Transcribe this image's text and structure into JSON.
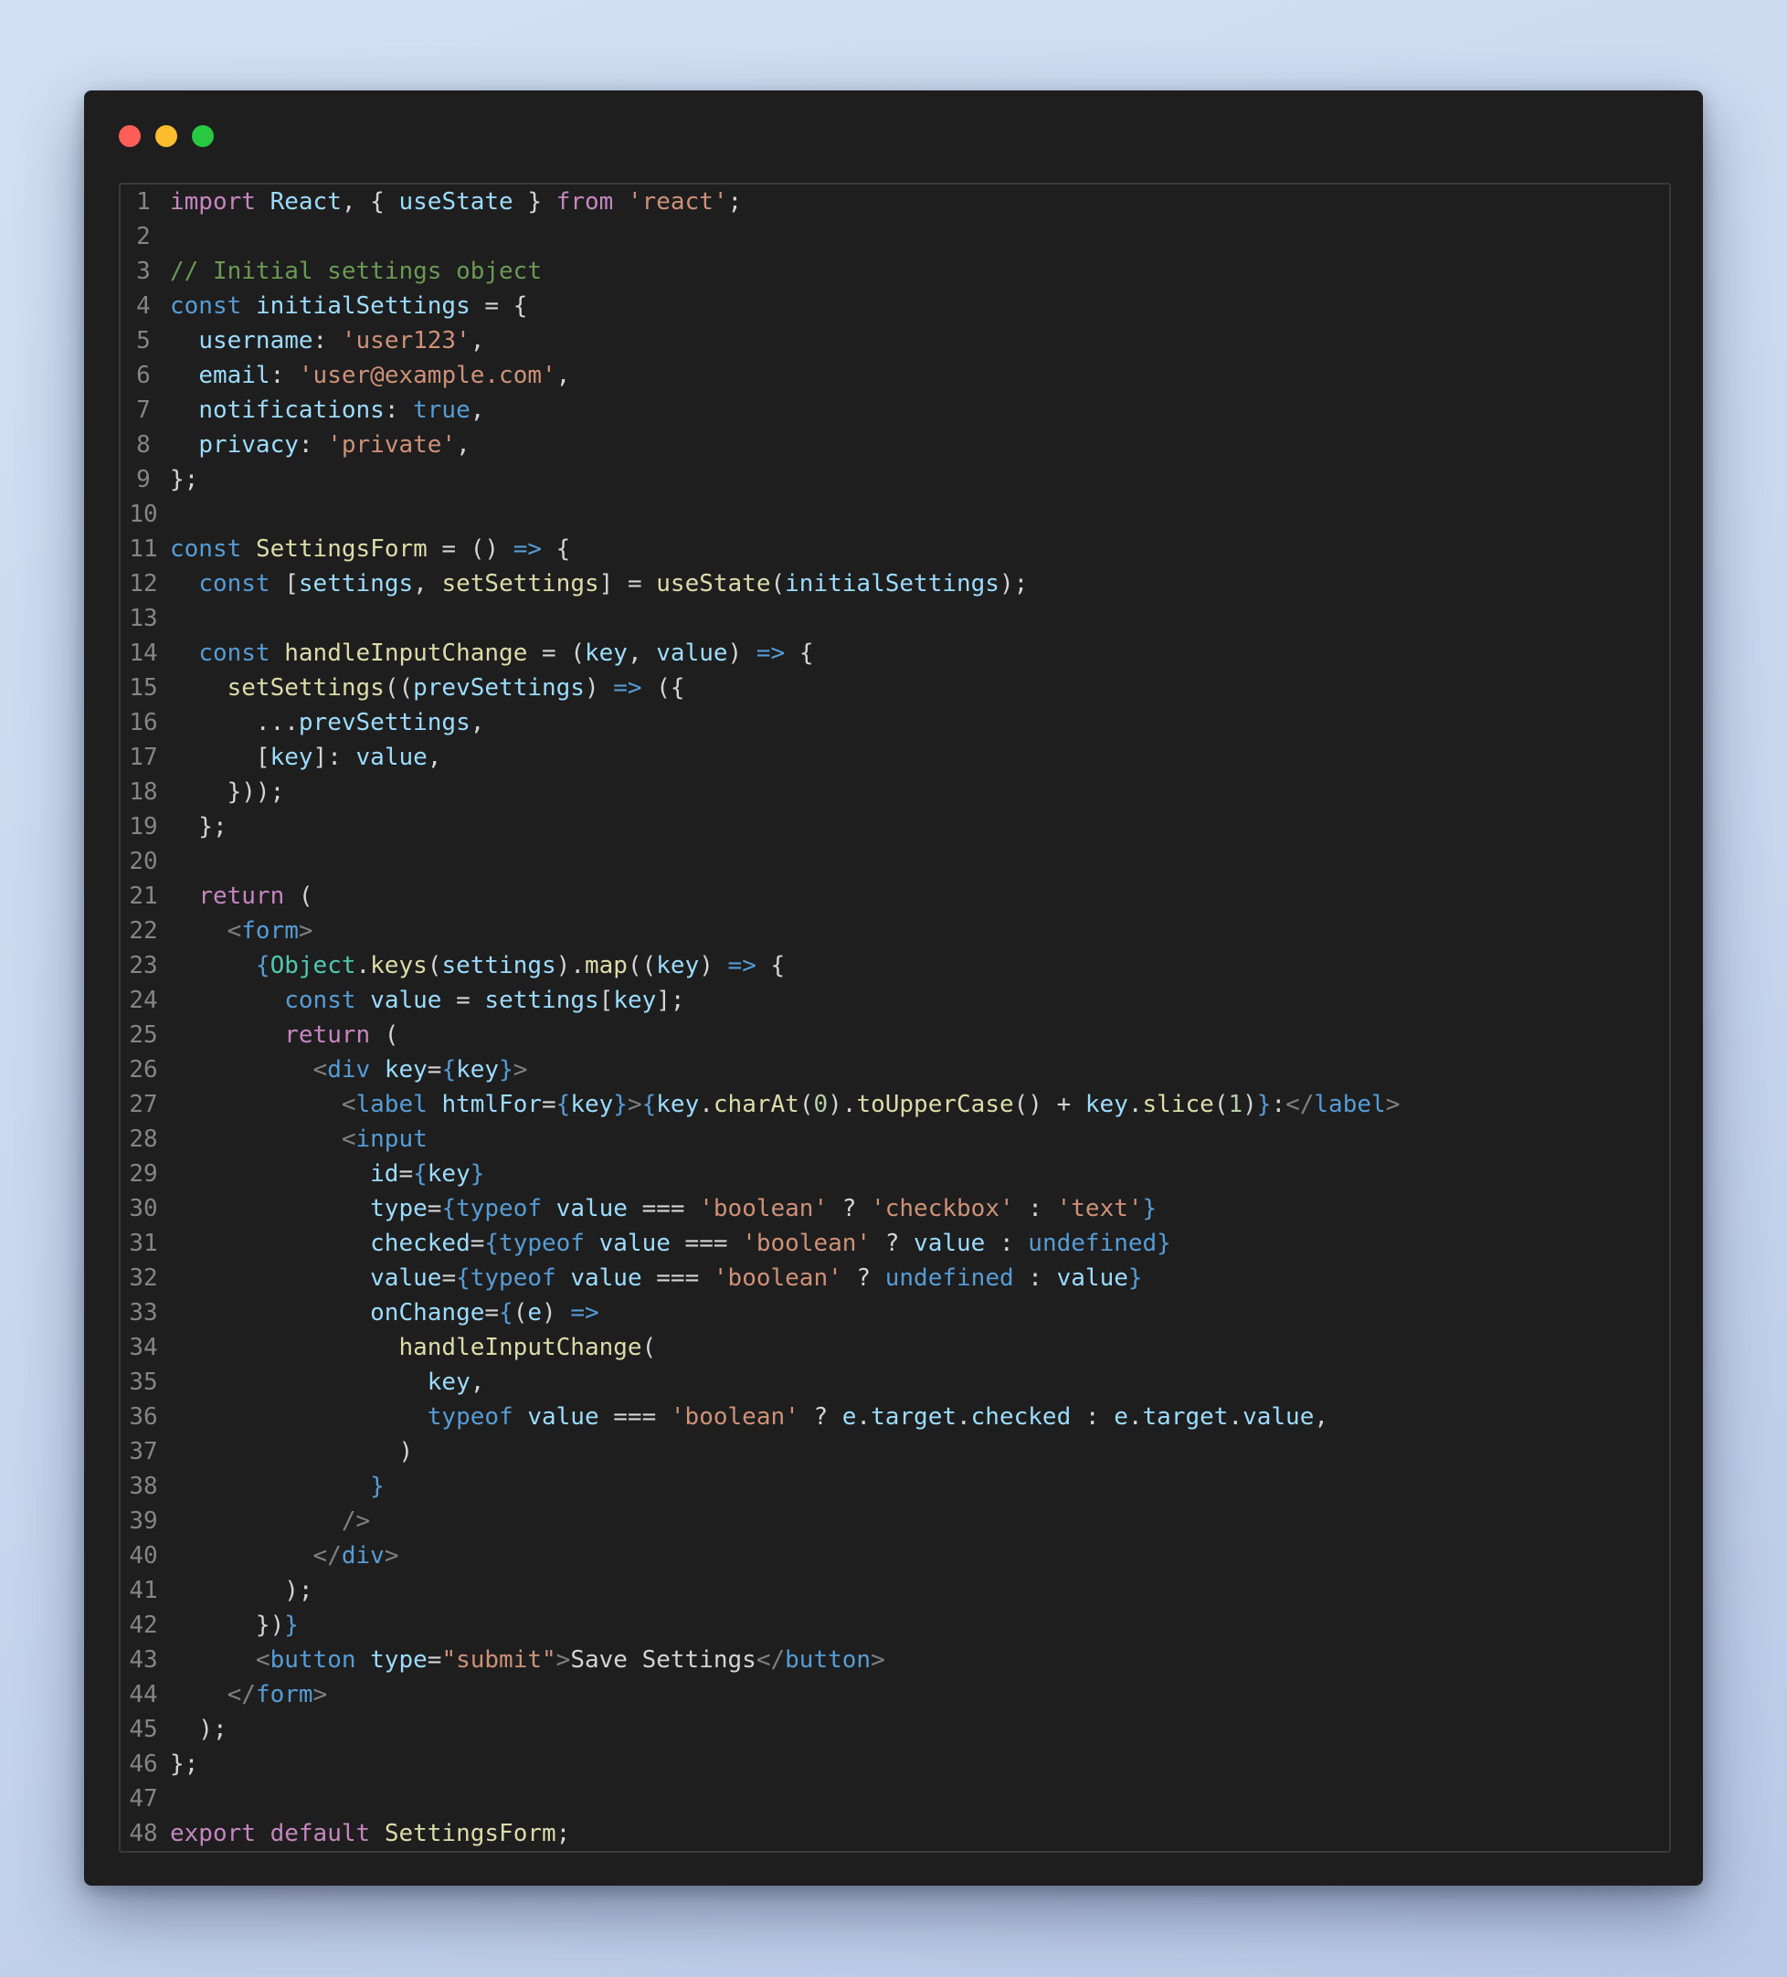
{
  "window": {
    "controls": [
      "close",
      "minimize",
      "zoom"
    ],
    "colors": {
      "close": "#ff5f57",
      "minimize": "#febc2e",
      "zoom": "#28c840",
      "background": "#1e1e1e"
    }
  },
  "code": {
    "language": "javascript",
    "lines": [
      [
        [
          "kw",
          "import"
        ],
        [
          "p",
          " "
        ],
        [
          "vr",
          "React"
        ],
        [
          "p",
          ", { "
        ],
        [
          "vr",
          "useState"
        ],
        [
          "p",
          " } "
        ],
        [
          "kw",
          "from"
        ],
        [
          "p",
          " "
        ],
        [
          "s",
          "'react'"
        ],
        [
          "p",
          ";"
        ]
      ],
      [],
      [
        [
          "cm",
          "// Initial settings object"
        ]
      ],
      [
        [
          "st",
          "const"
        ],
        [
          "p",
          " "
        ],
        [
          "vr",
          "initialSettings"
        ],
        [
          "p",
          " = {"
        ]
      ],
      [
        [
          "p",
          "  "
        ],
        [
          "vr",
          "username"
        ],
        [
          "p",
          ": "
        ],
        [
          "s",
          "'user123'"
        ],
        [
          "p",
          ","
        ]
      ],
      [
        [
          "p",
          "  "
        ],
        [
          "vr",
          "email"
        ],
        [
          "p",
          ": "
        ],
        [
          "s",
          "'user@example.com'"
        ],
        [
          "p",
          ","
        ]
      ],
      [
        [
          "p",
          "  "
        ],
        [
          "vr",
          "notifications"
        ],
        [
          "p",
          ": "
        ],
        [
          "st",
          "true"
        ],
        [
          "p",
          ","
        ]
      ],
      [
        [
          "p",
          "  "
        ],
        [
          "vr",
          "privacy"
        ],
        [
          "p",
          ": "
        ],
        [
          "s",
          "'private'"
        ],
        [
          "p",
          ","
        ]
      ],
      [
        [
          "p",
          "};"
        ]
      ],
      [],
      [
        [
          "st",
          "const"
        ],
        [
          "p",
          " "
        ],
        [
          "fn",
          "SettingsForm"
        ],
        [
          "p",
          " = () "
        ],
        [
          "st",
          "=>"
        ],
        [
          "p",
          " {"
        ]
      ],
      [
        [
          "p",
          "  "
        ],
        [
          "st",
          "const"
        ],
        [
          "p",
          " ["
        ],
        [
          "vr",
          "settings"
        ],
        [
          "p",
          ", "
        ],
        [
          "fn",
          "setSettings"
        ],
        [
          "p",
          "] = "
        ],
        [
          "fn",
          "useState"
        ],
        [
          "p",
          "("
        ],
        [
          "vr",
          "initialSettings"
        ],
        [
          "p",
          ");"
        ]
      ],
      [],
      [
        [
          "p",
          "  "
        ],
        [
          "st",
          "const"
        ],
        [
          "p",
          " "
        ],
        [
          "fn",
          "handleInputChange"
        ],
        [
          "p",
          " = ("
        ],
        [
          "vr",
          "key"
        ],
        [
          "p",
          ", "
        ],
        [
          "vr",
          "value"
        ],
        [
          "p",
          ") "
        ],
        [
          "st",
          "=>"
        ],
        [
          "p",
          " {"
        ]
      ],
      [
        [
          "p",
          "    "
        ],
        [
          "fn",
          "setSettings"
        ],
        [
          "p",
          "(("
        ],
        [
          "vr",
          "prevSettings"
        ],
        [
          "p",
          ") "
        ],
        [
          "st",
          "=>"
        ],
        [
          "p",
          " ({"
        ]
      ],
      [
        [
          "p",
          "      ..."
        ],
        [
          "vr",
          "prevSettings"
        ],
        [
          "p",
          ","
        ]
      ],
      [
        [
          "p",
          "      ["
        ],
        [
          "vr",
          "key"
        ],
        [
          "p",
          "]: "
        ],
        [
          "vr",
          "value"
        ],
        [
          "p",
          ","
        ]
      ],
      [
        [
          "p",
          "    }));"
        ]
      ],
      [
        [
          "p",
          "  };"
        ]
      ],
      [],
      [
        [
          "p",
          "  "
        ],
        [
          "kw",
          "return"
        ],
        [
          "p",
          " ("
        ]
      ],
      [
        [
          "p",
          "    "
        ],
        [
          "tg",
          "<"
        ],
        [
          "st",
          "form"
        ],
        [
          "tg",
          ">"
        ]
      ],
      [
        [
          "p",
          "      "
        ],
        [
          "st",
          "{"
        ],
        [
          "ty",
          "Object"
        ],
        [
          "p",
          "."
        ],
        [
          "fn",
          "keys"
        ],
        [
          "p",
          "("
        ],
        [
          "vr",
          "settings"
        ],
        [
          "p",
          ")."
        ],
        [
          "fn",
          "map"
        ],
        [
          "p",
          "(("
        ],
        [
          "vr",
          "key"
        ],
        [
          "p",
          ") "
        ],
        [
          "st",
          "=>"
        ],
        [
          "p",
          " {"
        ]
      ],
      [
        [
          "p",
          "        "
        ],
        [
          "st",
          "const"
        ],
        [
          "p",
          " "
        ],
        [
          "vr",
          "value"
        ],
        [
          "p",
          " = "
        ],
        [
          "vr",
          "settings"
        ],
        [
          "p",
          "["
        ],
        [
          "vr",
          "key"
        ],
        [
          "p",
          "];"
        ]
      ],
      [
        [
          "p",
          "        "
        ],
        [
          "kw",
          "return"
        ],
        [
          "p",
          " ("
        ]
      ],
      [
        [
          "p",
          "          "
        ],
        [
          "tg",
          "<"
        ],
        [
          "st",
          "div"
        ],
        [
          "p",
          " "
        ],
        [
          "vr",
          "key"
        ],
        [
          "p",
          "="
        ],
        [
          "st",
          "{"
        ],
        [
          "vr",
          "key"
        ],
        [
          "st",
          "}"
        ],
        [
          "tg",
          ">"
        ]
      ],
      [
        [
          "p",
          "            "
        ],
        [
          "tg",
          "<"
        ],
        [
          "st",
          "label"
        ],
        [
          "p",
          " "
        ],
        [
          "vr",
          "htmlFor"
        ],
        [
          "p",
          "="
        ],
        [
          "st",
          "{"
        ],
        [
          "vr",
          "key"
        ],
        [
          "st",
          "}"
        ],
        [
          "tg",
          ">"
        ],
        [
          "st",
          "{"
        ],
        [
          "vr",
          "key"
        ],
        [
          "p",
          "."
        ],
        [
          "fn",
          "charAt"
        ],
        [
          "p",
          "("
        ],
        [
          "nm",
          "0"
        ],
        [
          "p",
          ")."
        ],
        [
          "fn",
          "toUpperCase"
        ],
        [
          "p",
          "() + "
        ],
        [
          "vr",
          "key"
        ],
        [
          "p",
          "."
        ],
        [
          "fn",
          "slice"
        ],
        [
          "p",
          "("
        ],
        [
          "nm",
          "1"
        ],
        [
          "p",
          ")"
        ],
        [
          "st",
          "}"
        ],
        [
          "p",
          ":"
        ],
        [
          "tg",
          "</"
        ],
        [
          "st",
          "label"
        ],
        [
          "tg",
          ">"
        ]
      ],
      [
        [
          "p",
          "            "
        ],
        [
          "tg",
          "<"
        ],
        [
          "st",
          "input"
        ]
      ],
      [
        [
          "p",
          "              "
        ],
        [
          "vr",
          "id"
        ],
        [
          "p",
          "="
        ],
        [
          "st",
          "{"
        ],
        [
          "vr",
          "key"
        ],
        [
          "st",
          "}"
        ]
      ],
      [
        [
          "p",
          "              "
        ],
        [
          "vr",
          "type"
        ],
        [
          "p",
          "="
        ],
        [
          "st",
          "{typeof"
        ],
        [
          "p",
          " "
        ],
        [
          "vr",
          "value"
        ],
        [
          "p",
          " === "
        ],
        [
          "s",
          "'boolean'"
        ],
        [
          "p",
          " ? "
        ],
        [
          "s",
          "'checkbox'"
        ],
        [
          "p",
          " : "
        ],
        [
          "s",
          "'text'"
        ],
        [
          "st",
          "}"
        ]
      ],
      [
        [
          "p",
          "              "
        ],
        [
          "vr",
          "checked"
        ],
        [
          "p",
          "="
        ],
        [
          "st",
          "{typeof"
        ],
        [
          "p",
          " "
        ],
        [
          "vr",
          "value"
        ],
        [
          "p",
          " === "
        ],
        [
          "s",
          "'boolean'"
        ],
        [
          "p",
          " ? "
        ],
        [
          "vr",
          "value"
        ],
        [
          "p",
          " : "
        ],
        [
          "st",
          "undefined}"
        ]
      ],
      [
        [
          "p",
          "              "
        ],
        [
          "vr",
          "value"
        ],
        [
          "p",
          "="
        ],
        [
          "st",
          "{typeof"
        ],
        [
          "p",
          " "
        ],
        [
          "vr",
          "value"
        ],
        [
          "p",
          " === "
        ],
        [
          "s",
          "'boolean'"
        ],
        [
          "p",
          " ? "
        ],
        [
          "st",
          "undefined"
        ],
        [
          "p",
          " : "
        ],
        [
          "vr",
          "value"
        ],
        [
          "st",
          "}"
        ]
      ],
      [
        [
          "p",
          "              "
        ],
        [
          "vr",
          "onChange"
        ],
        [
          "p",
          "="
        ],
        [
          "st",
          "{"
        ],
        [
          "p",
          "("
        ],
        [
          "vr",
          "e"
        ],
        [
          "p",
          ") "
        ],
        [
          "st",
          "=>"
        ]
      ],
      [
        [
          "p",
          "                "
        ],
        [
          "fn",
          "handleInputChange"
        ],
        [
          "p",
          "("
        ]
      ],
      [
        [
          "p",
          "                  "
        ],
        [
          "vr",
          "key"
        ],
        [
          "p",
          ","
        ]
      ],
      [
        [
          "p",
          "                  "
        ],
        [
          "st",
          "typeof"
        ],
        [
          "p",
          " "
        ],
        [
          "vr",
          "value"
        ],
        [
          "p",
          " === "
        ],
        [
          "s",
          "'boolean'"
        ],
        [
          "p",
          " ? "
        ],
        [
          "vr",
          "e"
        ],
        [
          "p",
          "."
        ],
        [
          "vr",
          "target"
        ],
        [
          "p",
          "."
        ],
        [
          "vr",
          "checked"
        ],
        [
          "p",
          " : "
        ],
        [
          "vr",
          "e"
        ],
        [
          "p",
          "."
        ],
        [
          "vr",
          "target"
        ],
        [
          "p",
          "."
        ],
        [
          "vr",
          "value"
        ],
        [
          "p",
          ","
        ]
      ],
      [
        [
          "p",
          "                )"
        ]
      ],
      [
        [
          "p",
          "              "
        ],
        [
          "st",
          "}"
        ]
      ],
      [
        [
          "p",
          "            "
        ],
        [
          "tg",
          "/>"
        ]
      ],
      [
        [
          "p",
          "          "
        ],
        [
          "tg",
          "</"
        ],
        [
          "st",
          "div"
        ],
        [
          "tg",
          ">"
        ]
      ],
      [
        [
          "p",
          "        );"
        ]
      ],
      [
        [
          "p",
          "      })"
        ],
        [
          "st",
          "}"
        ]
      ],
      [
        [
          "p",
          "      "
        ],
        [
          "tg",
          "<"
        ],
        [
          "st",
          "button"
        ],
        [
          "p",
          " "
        ],
        [
          "vr",
          "type"
        ],
        [
          "p",
          "="
        ],
        [
          "s",
          "\"submit\""
        ],
        [
          "tg",
          ">"
        ],
        [
          "p",
          "Save Settings"
        ],
        [
          "tg",
          "</"
        ],
        [
          "st",
          "button"
        ],
        [
          "tg",
          ">"
        ]
      ],
      [
        [
          "p",
          "    "
        ],
        [
          "tg",
          "</"
        ],
        [
          "st",
          "form"
        ],
        [
          "tg",
          ">"
        ]
      ],
      [
        [
          "p",
          "  );"
        ]
      ],
      [
        [
          "p",
          "};"
        ]
      ],
      [],
      [
        [
          "kw",
          "export"
        ],
        [
          "p",
          " "
        ],
        [
          "kw",
          "default"
        ],
        [
          "p",
          " "
        ],
        [
          "fn",
          "SettingsForm"
        ],
        [
          "p",
          ";"
        ]
      ]
    ]
  }
}
